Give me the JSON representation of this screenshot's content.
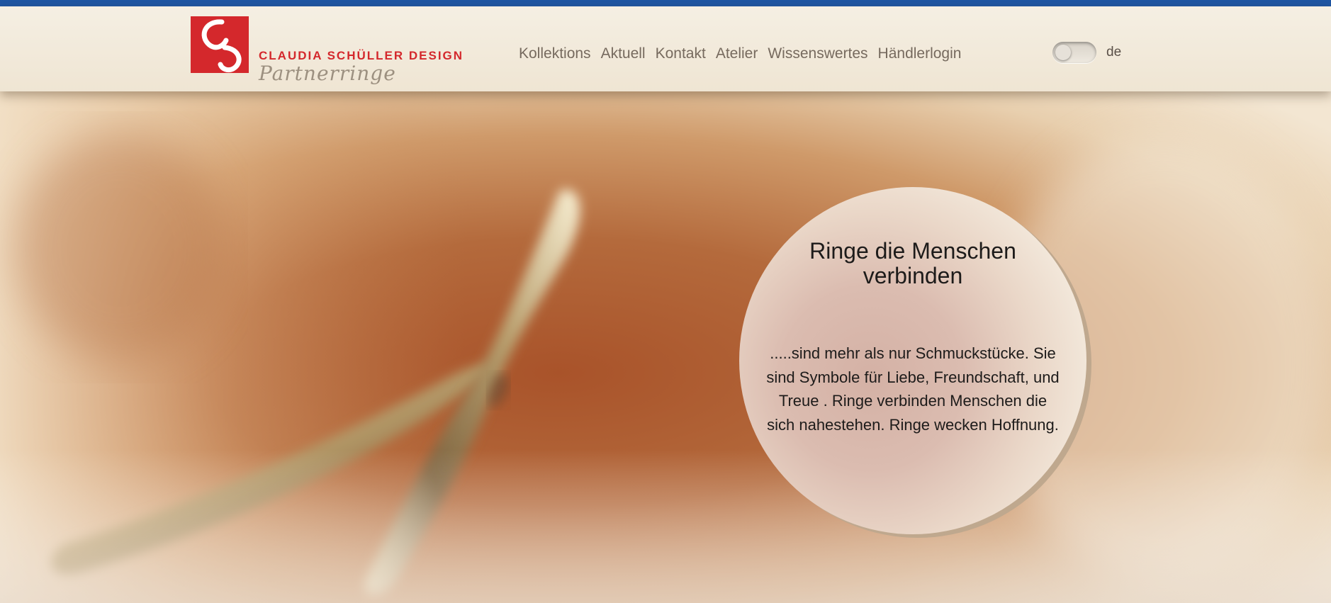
{
  "header": {
    "logo": {
      "title": "CLAUDIA SCHÜLLER DESIGN",
      "subtitle": "Partnerringe",
      "mark_color": "#d4282c"
    },
    "nav": [
      {
        "label": "Kollektions"
      },
      {
        "label": "Aktuell"
      },
      {
        "label": "Kontakt"
      },
      {
        "label": "Atelier"
      },
      {
        "label": "Wissenswertes"
      },
      {
        "label": "Händlerlogin"
      }
    ],
    "language": {
      "label": "de"
    }
  },
  "hero": {
    "image_alt": "two interlocked gold rings",
    "circle": {
      "title": "Ringe die Menschen verbinden",
      "text": ".....sind mehr als nur Schmuckstücke. Sie sind Symbole für Liebe, Freundschaft, und Treue . Ringe verbinden Menschen die sich nahestehen. Ringe wecken Hoffnung."
    }
  },
  "colors": {
    "top_bar": "#1f56a3",
    "header_bg": "#f3ecdf",
    "nav_text": "#766a5e",
    "accent": "#d4282c"
  }
}
